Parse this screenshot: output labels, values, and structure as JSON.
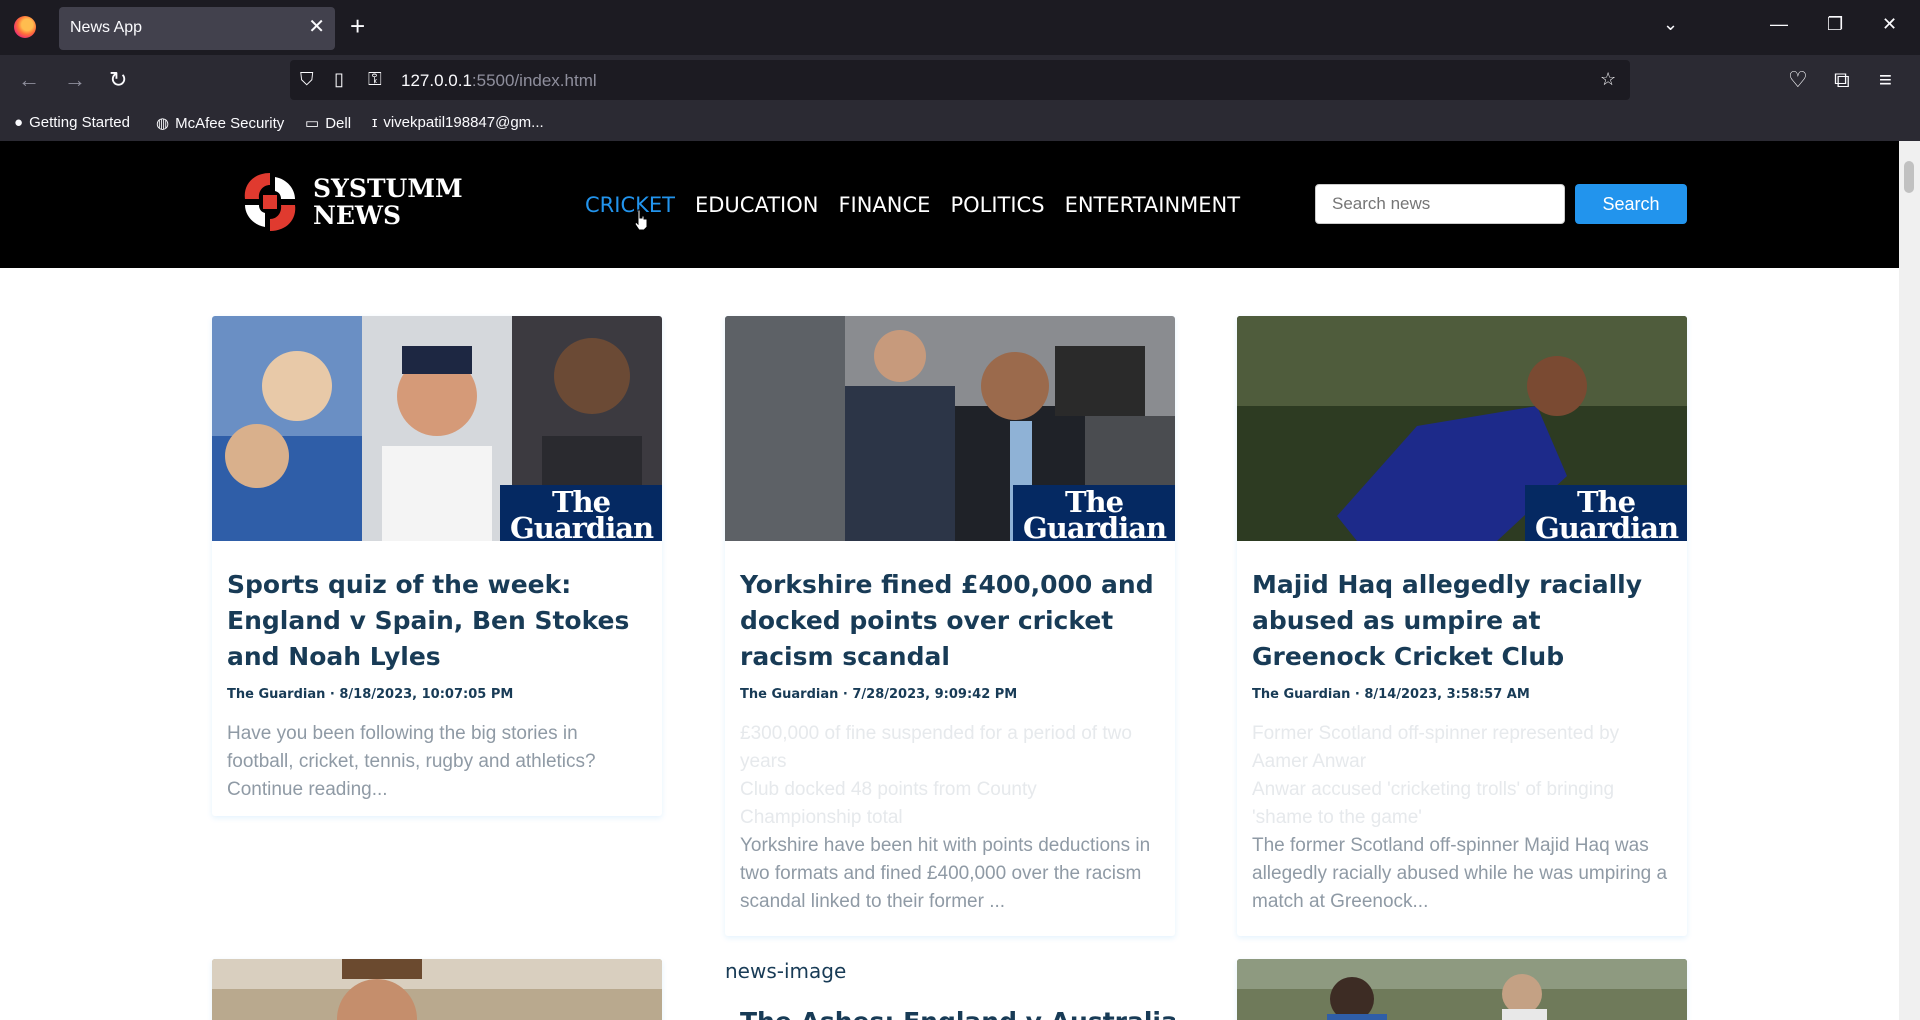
{
  "browser": {
    "tab_title": "News App",
    "url_host": "127.0.0.1",
    "url_rest": ":5500/index.html",
    "bookmarks": [
      "Getting Started",
      "McAfee Security",
      "Dell",
      "vivekpatil198847@gm..."
    ]
  },
  "site": {
    "logo_line1": "SYSTUMM",
    "logo_line2": "NEWS",
    "nav": [
      "CRICKET",
      "EDUCATION",
      "FINANCE",
      "POLITICS",
      "ENTERTAINMENT"
    ],
    "active_nav": "CRICKET",
    "search_placeholder": "Search news",
    "search_button": "Search"
  },
  "guardian_label_1": "The",
  "guardian_label_2": "Guardian",
  "cards": [
    {
      "title": "Sports quiz of the week: England v Spain, Ben Stokes and Noah Lyles",
      "meta": "The Guardian · 8/18/2023, 10:07:05 PM",
      "desc": "Have you been following the big stories in football, cricket, tennis, rugby and athletics? Continue reading..."
    },
    {
      "title": "Yorkshire fined £400,000 and docked points over cricket racism scandal",
      "meta": "The Guardian · 7/28/2023, 9:09:42 PM",
      "desc_faint": "£300,000 of fine suspended for a period of two years\nClub docked 48 points from County Championship total",
      "desc": "Yorkshire have been hit with points deductions in two formats and fined £400,000 over the racism scandal linked to their former ..."
    },
    {
      "title": "Majid Haq allegedly racially abused as umpire at Greenock Cricket Club",
      "meta": "The Guardian · 8/14/2023, 3:58:57 AM",
      "desc_faint": "Former Scotland off-spinner represented by Aamer Anwar\nAnwar accused 'cricketing trolls' of bringing 'shame to the game'",
      "desc": "The former Scotland off-spinner Majid Haq was allegedly racially abused while he was umpiring a match at Greenock..."
    }
  ],
  "row2": {
    "alt_text": "news-image",
    "title_partial": "The Ashes: England v Australia"
  }
}
